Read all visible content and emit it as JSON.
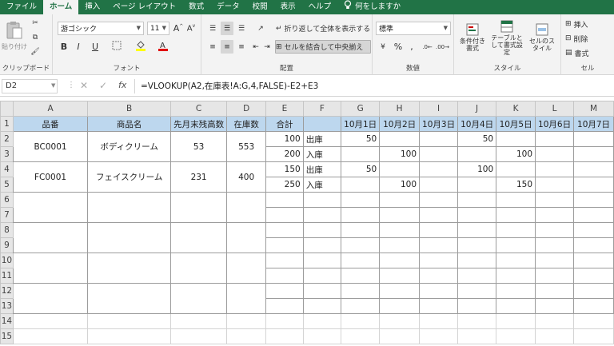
{
  "tabs": [
    "ファイル",
    "ホーム",
    "挿入",
    "ページ レイアウト",
    "数式",
    "データ",
    "校閲",
    "表示",
    "ヘルプ"
  ],
  "tell_me": "何をしますか",
  "ribbon": {
    "clipboard": {
      "paste": "貼り付け",
      "label": "クリップボード"
    },
    "font": {
      "name": "游ゴシック",
      "size": "11",
      "bold": "B",
      "italic": "I",
      "underline": "U",
      "label": "フォント"
    },
    "alignment": {
      "wrap": "折り返して全体を表示する",
      "merge": "セルを結合して中央揃え",
      "label": "配置"
    },
    "number": {
      "format": "標準",
      "label": "数値"
    },
    "styles": {
      "conditional": "条件付き書式",
      "table": "テーブルとして書式設定",
      "cell": "セルのスタイル",
      "label": "スタイル"
    },
    "cells": {
      "insert": "挿入",
      "delete": "削除",
      "format": "書式",
      "label": "セル"
    }
  },
  "formula_bar": {
    "cell": "D2",
    "fx": "fx",
    "formula": "=VLOOKUP(A2,在庫表!A:G,4,FALSE)-E2+E3"
  },
  "columns": [
    "A",
    "B",
    "C",
    "D",
    "E",
    "F",
    "G",
    "H",
    "I",
    "J",
    "K",
    "L",
    "M"
  ],
  "rows": [
    "1",
    "2",
    "3",
    "4",
    "5",
    "6",
    "7",
    "8",
    "9",
    "10",
    "11",
    "12",
    "13",
    "14",
    "15"
  ],
  "header": [
    "品番",
    "商品名",
    "先月末残高数",
    "在庫数",
    "合計",
    "",
    "10月1日",
    "10月2日",
    "10月3日",
    "10月4日",
    "10月5日",
    "10月6日",
    "10月7日"
  ],
  "products": [
    {
      "code": "BC0001",
      "name": "ボディクリーム",
      "prev": "53",
      "stock": "553",
      "lines": [
        {
          "total": "100",
          "type": "出庫",
          "d1": "50",
          "d2": "",
          "d3": "",
          "d4": "50",
          "d5": ""
        },
        {
          "total": "200",
          "type": "入庫",
          "d1": "",
          "d2": "100",
          "d3": "",
          "d4": "",
          "d5": "100"
        }
      ]
    },
    {
      "code": "FC0001",
      "name": "フェイスクリーム",
      "prev": "231",
      "stock": "400",
      "lines": [
        {
          "total": "150",
          "type": "出庫",
          "d1": "50",
          "d2": "",
          "d3": "",
          "d4": "100",
          "d5": ""
        },
        {
          "total": "250",
          "type": "入庫",
          "d1": "",
          "d2": "100",
          "d3": "",
          "d4": "",
          "d5": "150"
        }
      ]
    }
  ]
}
